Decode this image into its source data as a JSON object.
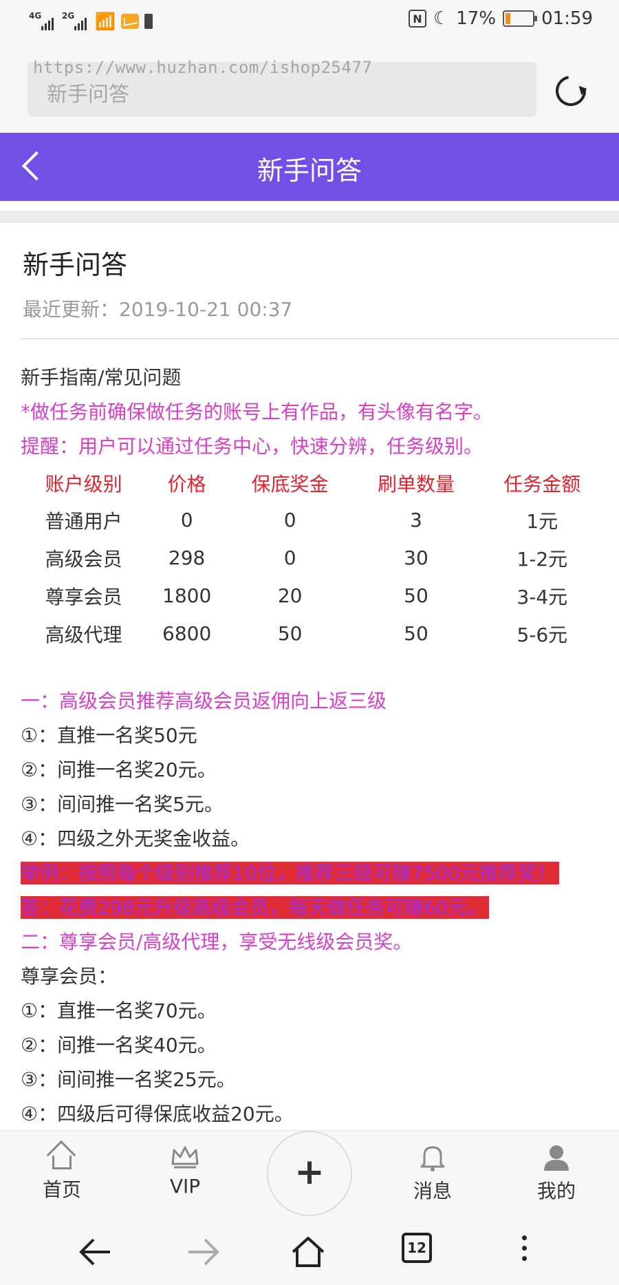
{
  "status_bar": {
    "sim1": "4G",
    "sim2": "2G",
    "battery_percent": "17%",
    "time": "01:59",
    "battery_level": 0.17
  },
  "browser": {
    "url_watermark": "https://www.huzhan.com/ishop25477",
    "address_text": "新手问答"
  },
  "header": {
    "title": "新手问答"
  },
  "article": {
    "title": "新手问答",
    "updated": "最近更新：2019-10-21 00:37",
    "intro": "新手指南/常见问题",
    "notice1": "*做任务前确保做任务的账号上有作品，有头像有名字。",
    "notice2": "提醒：用户可以通过任务中心，快速分辨，任务级别。",
    "table": {
      "headers": [
        "账户级别",
        "价格",
        "保底奖金",
        "刷单数量",
        "任务金额"
      ],
      "rows": [
        [
          "普通用户",
          "0",
          "0",
          "3",
          "1元"
        ],
        [
          "高级会员",
          "298",
          "0",
          "30",
          "1-2元"
        ],
        [
          "尊享会员",
          "1800",
          "20",
          "50",
          "3-4元"
        ],
        [
          "高级代理",
          "6800",
          "50",
          "50",
          "5-6元"
        ]
      ]
    },
    "section1_title": "一：高级会员推荐高级会员返佣向上返三级",
    "section1_items": [
      "①：直推一名奖50元",
      "②：间推一名奖20元。",
      "③：间间推一名奖5元。",
      "④：四级之外无奖金收益。"
    ],
    "example": "举例：按照每个级别推荐10位，推荐三级可赚7500元推荐奖！",
    "answer": "答：花费298元升级高级会员，每天做任务可赚60元。",
    "section2_title": "二：尊享会员/高级代理，享受无线级会员奖。",
    "section2_sub": "尊享会员：",
    "section2_items": [
      "①：直推一名奖70元。",
      "②：间推一名奖40元。",
      "③：间间推一名奖25元。",
      "④：四级后可得保底收益20元。"
    ]
  },
  "bottom_nav": {
    "home": "首页",
    "vip": "VIP",
    "plus": "+",
    "messages": "消息",
    "mine": "我的"
  },
  "system_nav": {
    "tab_count": "12"
  },
  "colors": {
    "header": "#7350e5",
    "magenta_text": "#d63fc9",
    "table_header": "#e0242f",
    "highlight_bg": "#e02c37"
  }
}
